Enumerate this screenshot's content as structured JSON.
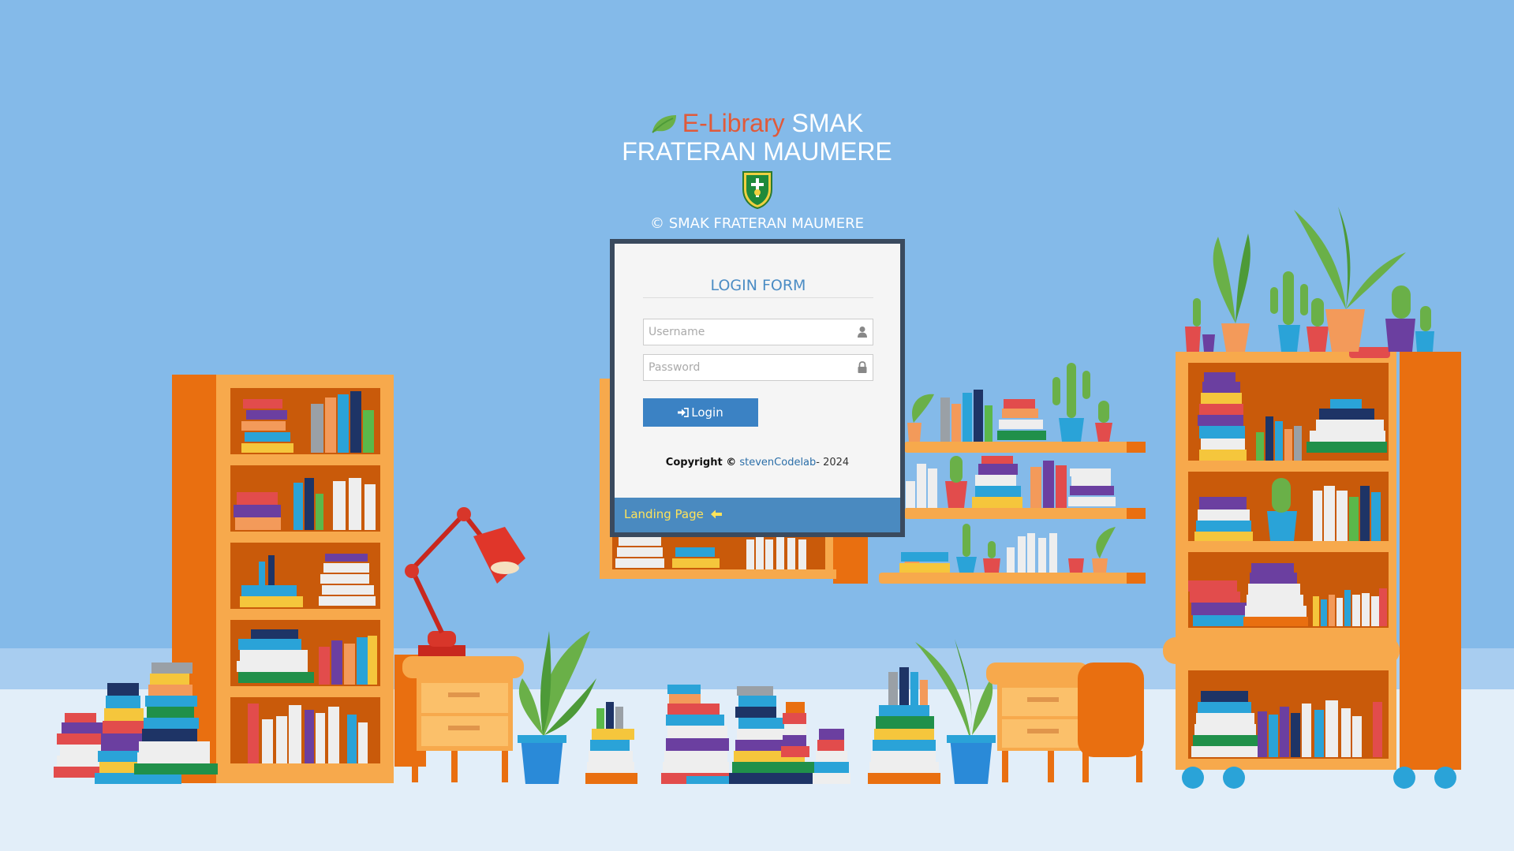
{
  "header": {
    "title_accent": "E-Library",
    "title_rest": "SMAK",
    "title_line2": "FRATERAN MAUMERE",
    "copyright": "© SMAK FRATERAN MAUMERE"
  },
  "login": {
    "form_title": "LOGIN FORM",
    "username_placeholder": "Username",
    "username_value": "",
    "password_placeholder": "Password",
    "password_value": "",
    "login_label": "Login",
    "copyright_label": "Copyright ©",
    "author_link": "stevenCodelab",
    "year_suffix": "- 2024",
    "landing_link": "Landing Page"
  },
  "icons": {
    "brand": "leaf-icon",
    "crest": "school-crest-icon",
    "username": "user-icon",
    "password": "lock-icon",
    "login": "sign-in-icon",
    "landing": "arrow-left-icon"
  },
  "colors": {
    "sky": "#84bae9",
    "floor": "#e2eef9",
    "accent": "#e05a3a",
    "button": "#3b82c4",
    "landing_bar": "#4a8ac0",
    "landing_text": "#ffe35a",
    "frame": "#3a4a5e"
  }
}
